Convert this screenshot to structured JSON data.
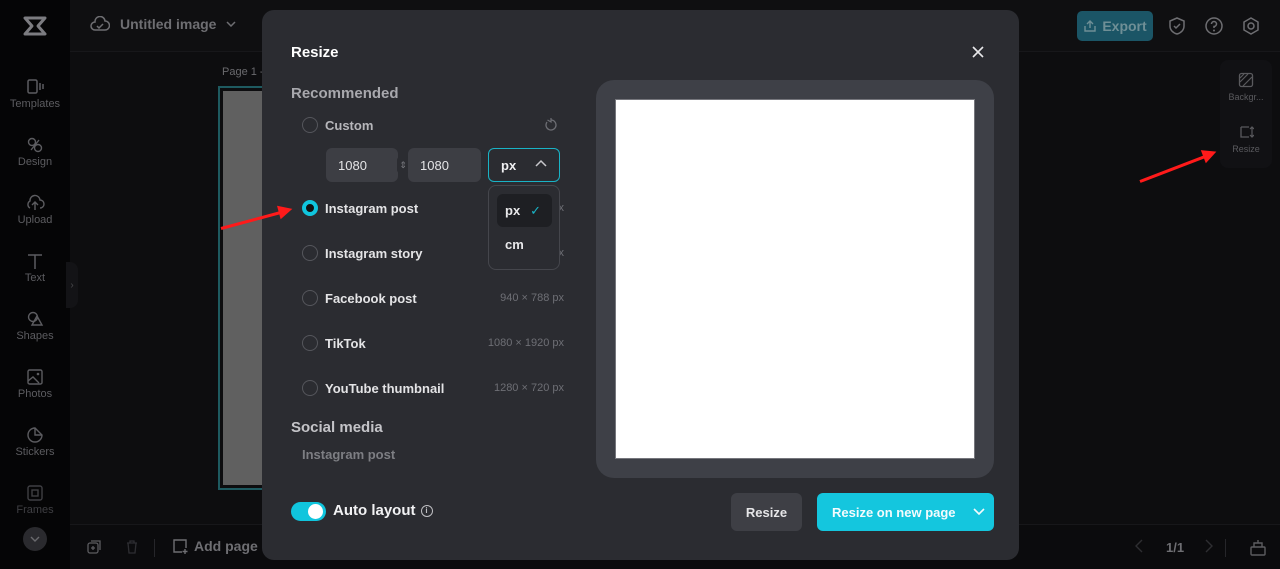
{
  "app": {
    "doc_title": "Untitled image",
    "export_label": "Export",
    "page_label": "Page 1 -",
    "rail": [
      {
        "label": "Templates",
        "icon": "templates-icon"
      },
      {
        "label": "Design",
        "icon": "design-icon"
      },
      {
        "label": "Upload",
        "icon": "upload-icon"
      },
      {
        "label": "Text",
        "icon": "text-icon"
      },
      {
        "label": "Shapes",
        "icon": "shapes-icon"
      },
      {
        "label": "Photos",
        "icon": "photos-icon"
      },
      {
        "label": "Stickers",
        "icon": "stickers-icon"
      },
      {
        "label": "Frames",
        "icon": "frames-icon"
      }
    ],
    "right_panel": [
      {
        "label": "Backgr...",
        "icon": "background-icon"
      },
      {
        "label": "Resize",
        "icon": "resize-icon"
      }
    ],
    "bottom": {
      "add_page_label": "Add page",
      "pager": "1/1"
    }
  },
  "modal": {
    "title": "Resize",
    "recommended_label": "Recommended",
    "custom": {
      "label": "Custom",
      "width": "1080",
      "height": "1080",
      "unit": "px",
      "unit_options": [
        {
          "label": "px",
          "selected": true
        },
        {
          "label": "cm",
          "selected": false
        }
      ]
    },
    "presets": [
      {
        "label": "Instagram post",
        "size": "1080 × 1080 px",
        "selected": true
      },
      {
        "label": "Instagram story",
        "size": "1080 × 1920 px",
        "selected": false
      },
      {
        "label": "Facebook post",
        "size": "940 × 788 px",
        "selected": false
      },
      {
        "label": "TikTok",
        "size": "1080 × 1920 px",
        "selected": false
      },
      {
        "label": "YouTube thumbnail",
        "size": "1280 × 720 px",
        "selected": false
      }
    ],
    "social_media_label": "Social media",
    "social_media_items": [
      "Instagram post"
    ],
    "auto_layout_label": "Auto layout",
    "auto_layout_on": true,
    "resize_label": "Resize",
    "resize_new_page_label": "Resize on new page"
  },
  "colors": {
    "accent": "#14c6de",
    "modal_bg": "#2b2c31",
    "annotation_arrow": "#ff1a1a"
  }
}
